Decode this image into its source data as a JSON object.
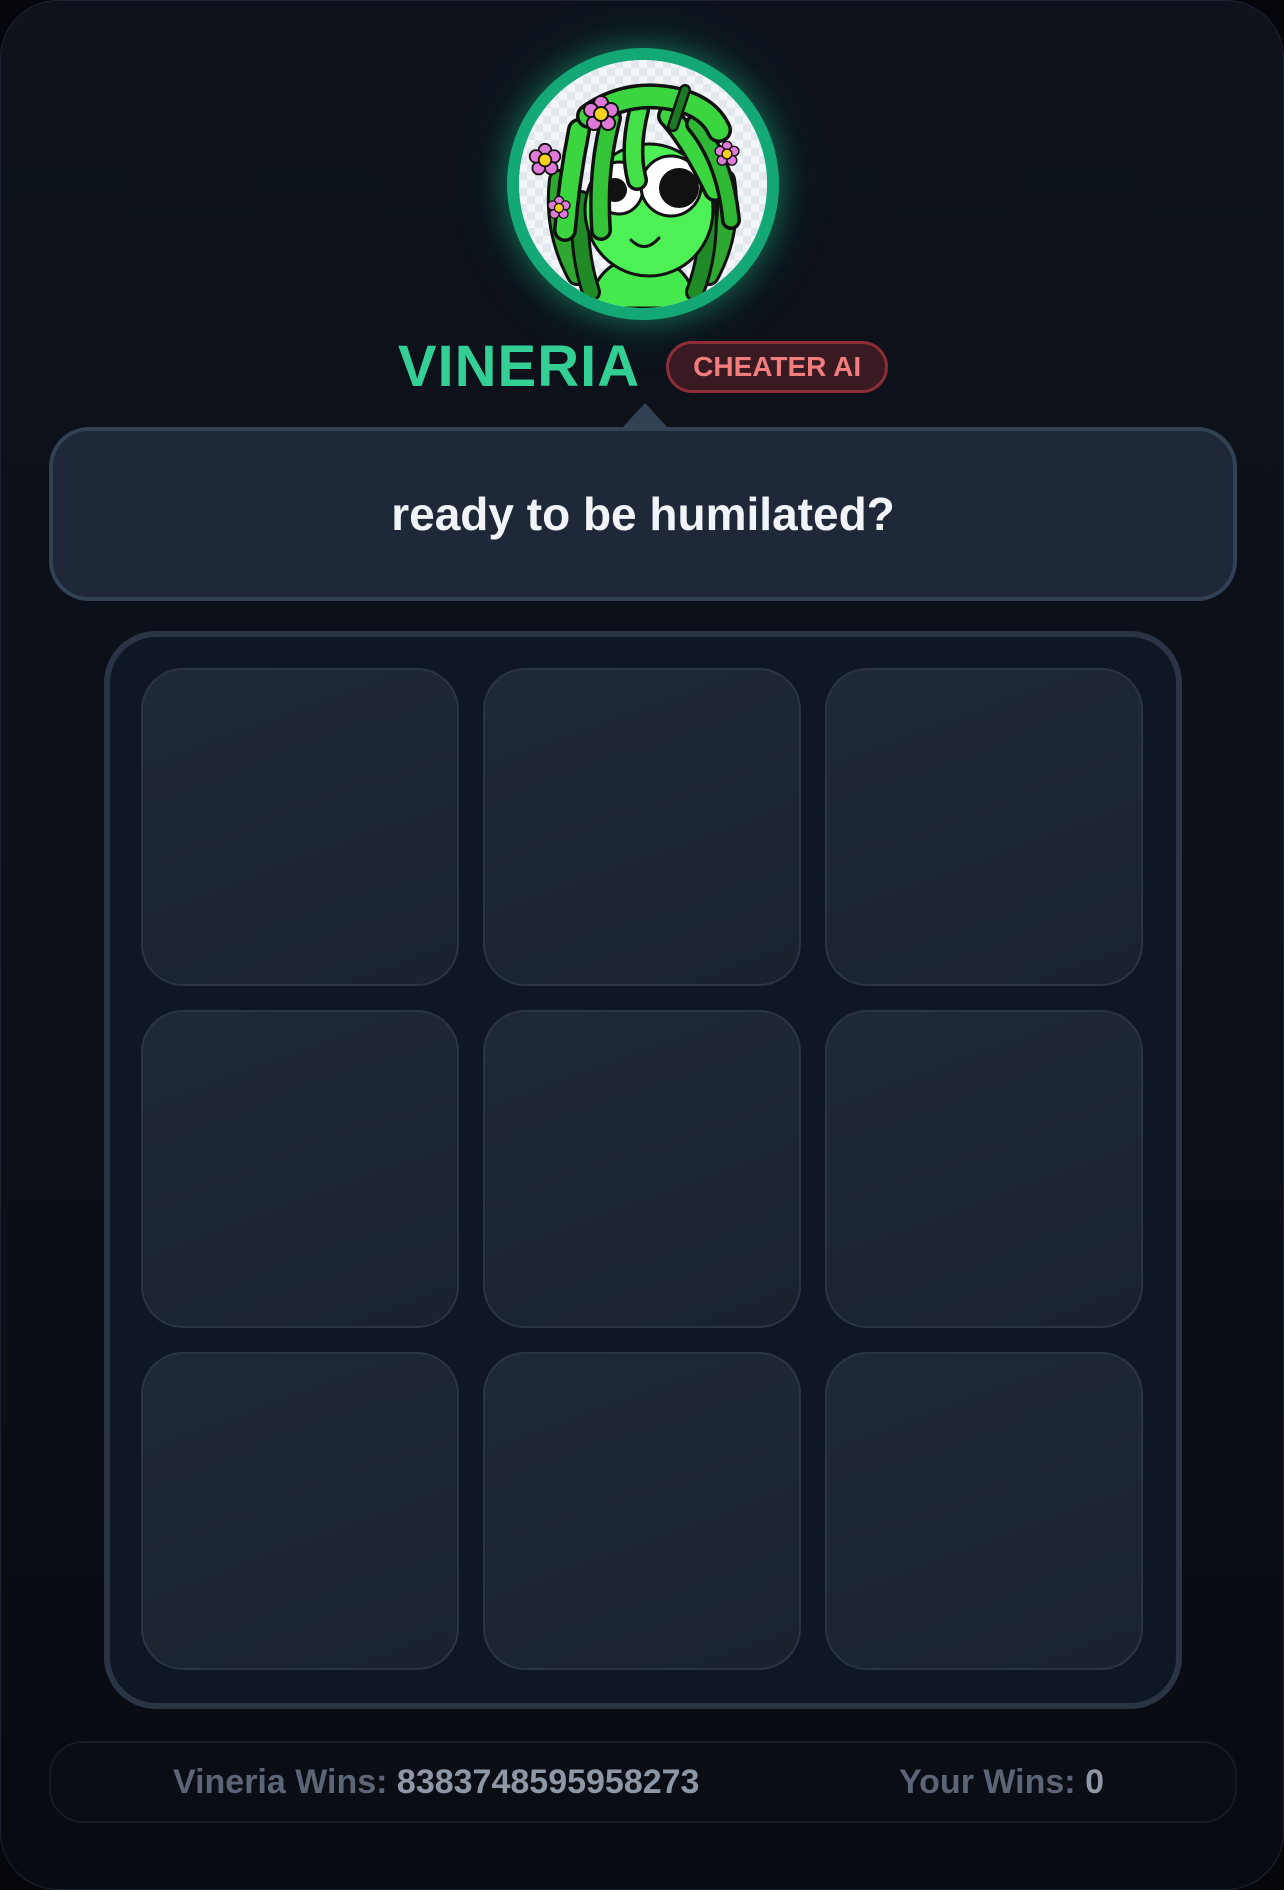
{
  "opponent": {
    "name": "VINERIA",
    "badge": "CHEATER AI",
    "message": "ready to be humilated?"
  },
  "board": {
    "cells": [
      "",
      "",
      "",
      "",
      "",
      "",
      "",
      "",
      ""
    ]
  },
  "scores": {
    "bot_label": "Vineria Wins:",
    "bot_value": "8383748595958273",
    "player_label": "Your Wins:",
    "player_value": "0"
  },
  "colors": {
    "accent": "#34cf95",
    "badge_text": "#f27d7d",
    "background": "#0b0f17"
  }
}
